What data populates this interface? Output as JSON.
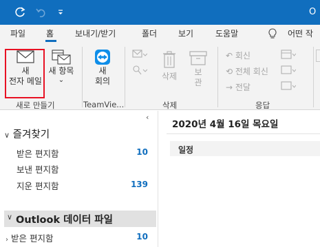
{
  "titlebar": {
    "title": "O",
    "colors": {
      "background": "#106ebe"
    }
  },
  "tabs": [
    {
      "label": "파일",
      "active": false
    },
    {
      "label": "홈",
      "active": true
    },
    {
      "label": "보내기/받기",
      "active": false
    },
    {
      "label": "폴더",
      "active": false
    },
    {
      "label": "보기",
      "active": false
    },
    {
      "label": "도움말",
      "active": false
    },
    {
      "label": "어떤 작",
      "active": false
    }
  ],
  "ribbon": {
    "new_mail": {
      "line1": "새",
      "line2": "전자 메일"
    },
    "new_items": {
      "line1": "새 항목"
    },
    "teamviewer_meeting": {
      "line1": "새",
      "line2": "회의"
    },
    "delete_label": "삭제",
    "archive": {
      "line1": "보",
      "line2": "관"
    },
    "reply_label": "회신",
    "reply_all_label": "전체 회신",
    "forward_label": "전달",
    "groups": {
      "new": "새로 만들기",
      "teamviewer": "TeamVie...",
      "delete": "삭제",
      "respond": "응답"
    }
  },
  "folders": {
    "favorites_header": "즐겨찾기",
    "favorites": [
      {
        "name": "받은 편지함",
        "count": "10"
      },
      {
        "name": "보낸 편지함",
        "count": ""
      },
      {
        "name": "지운 편지함",
        "count": "139"
      }
    ],
    "datafile_header": "Outlook 데이터 파일",
    "datafile_items": [
      {
        "name": "받은 편지함",
        "count": "10"
      }
    ]
  },
  "calendar": {
    "date": "2020년 4월 16일 목요일",
    "schedule_header": "일정"
  },
  "colors": {
    "accent": "#106ebe",
    "highlight_box": "#e81123"
  }
}
